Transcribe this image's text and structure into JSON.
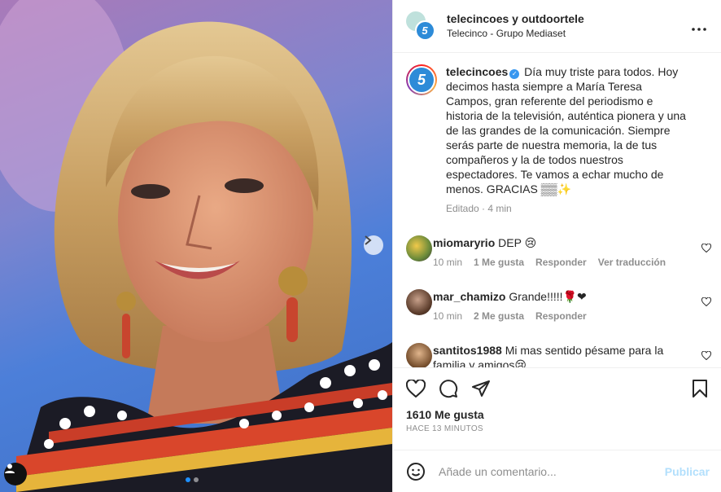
{
  "media": {
    "next_icon": "chevron-right-icon",
    "user_tag_icon": "user-icon",
    "carousel_count": 2,
    "carousel_active": 0
  },
  "header": {
    "title": "telecincoes y outdoortele",
    "subtitle": "Telecinco - Grupo Mediaset",
    "more_icon": "more-horizontal-icon",
    "avatar_letter": "5"
  },
  "caption": {
    "username": "telecincoes",
    "verified_icon": "verified-badge-icon",
    "text": "Día muy triste para todos. Hoy decimos hasta siempre a María Teresa Campos, gran referente del periodismo e historia de la televisión, auténtica pionera y una de las grandes de la comunicación. Siempre serás parte de nuestra memoria, la de tus compañeros y la de todos nuestros espectadores. Te vamos a echar mucho de menos. GRACIAS ▒▒✨",
    "edited": "Editado",
    "time": "4 min",
    "avatar_letter": "5"
  },
  "comments": [
    {
      "username": "miomaryrio",
      "text": "DEP 😢",
      "time": "10 min",
      "likes": "1 Me gusta",
      "reply": "Responder",
      "translate": "Ver traducción"
    },
    {
      "username": "mar_chamizo",
      "text": "Grande!!!!!🌹❤",
      "time": "10 min",
      "likes": "2 Me gusta",
      "reply": "Responder"
    },
    {
      "username": "santitos1988",
      "text": "Mi mas sentido pésame para la familia y amigos😢"
    }
  ],
  "actions": {
    "like_icon": "heart-icon",
    "comment_icon": "comment-icon",
    "share_icon": "send-icon",
    "save_icon": "bookmark-icon"
  },
  "stats": {
    "likes": "1610 Me gusta",
    "time_ago": "HACE 13 MINUTOS"
  },
  "add_comment": {
    "emoji_icon": "smiley-icon",
    "placeholder": "Añade un comentario...",
    "post_label": "Publicar"
  }
}
